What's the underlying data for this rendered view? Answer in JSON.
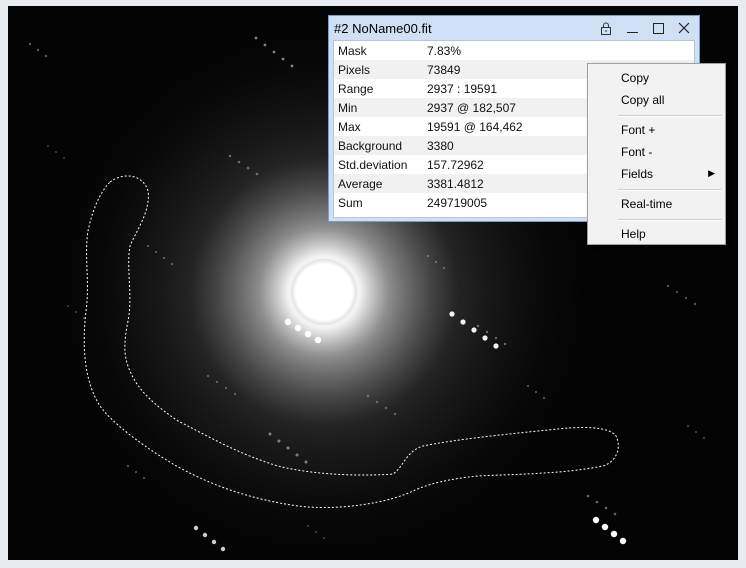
{
  "viewer": {
    "label": "FITS image viewer"
  },
  "stats_window": {
    "title": "#2 NoName00.fit",
    "buttons": {
      "lock_icon": "lock-icon",
      "minimize": "minimize-icon",
      "maximize": "maximize-icon",
      "close": "close-icon"
    },
    "rows": [
      {
        "key": "Mask",
        "value": "7.83%"
      },
      {
        "key": "Pixels",
        "value": "73849"
      },
      {
        "key": "Range",
        "value": "2937 : 19591"
      },
      {
        "key": "Min",
        "value": "2937 @ 182,507"
      },
      {
        "key": "Max",
        "value": "19591 @ 164,462"
      },
      {
        "key": "Background",
        "value": "3380"
      },
      {
        "key": "Std.deviation",
        "value": "157.72962"
      },
      {
        "key": "Average",
        "value": "3381.4812"
      },
      {
        "key": "Sum",
        "value": "249719005"
      }
    ]
  },
  "context_menu": {
    "items": {
      "copy": "Copy",
      "copy_all": "Copy all",
      "font_plus": "Font +",
      "font_minus": "Font -",
      "fields": "Fields",
      "realtime": "Real-time",
      "help": "Help"
    }
  }
}
